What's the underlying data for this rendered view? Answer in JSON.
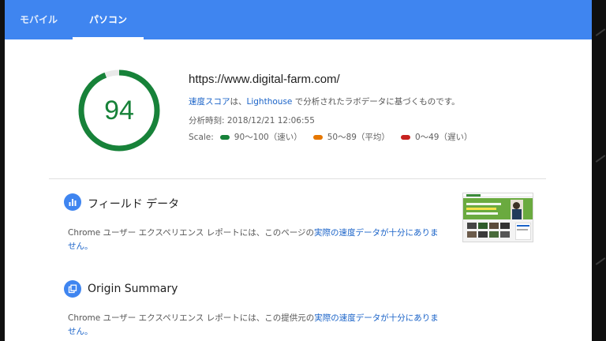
{
  "tabs": [
    {
      "label": "モバイル"
    },
    {
      "label": "パソコン"
    }
  ],
  "score": {
    "value": 94,
    "text": "94",
    "color": "#178239"
  },
  "summary": {
    "url": "https://www.digital-farm.com/",
    "desc_link1": "速度スコア",
    "desc_mid": "は、",
    "desc_link2": "Lighthouse",
    "desc_tail": " で分析されたラボデータに基づくものです。",
    "timestamp": "分析時刻: 2018/12/21 12:06:55"
  },
  "scale": {
    "label": "Scale:",
    "items": [
      {
        "text": "90～100（速い）",
        "color": "#178239"
      },
      {
        "text": "50～89（平均）",
        "color": "#e67700"
      },
      {
        "text": "0～49（遅い）",
        "color": "#c7221f"
      }
    ]
  },
  "field": {
    "title": "フィールド データ",
    "icon": "bar-chart-icon",
    "body_text": "Chrome ユーザー エクスペリエンス レポートには、このページの",
    "body_link": "実際の速度データが十分にありません。"
  },
  "origin": {
    "title": "Origin Summary",
    "icon": "copy-pages-icon",
    "body_text": "Chrome ユーザー エクスペリエンス レポートには、この提供元の",
    "body_link": "実際の速度データが十分にありません。"
  },
  "colors": {
    "accent": "#3f85f0",
    "link": "#1a63c8"
  }
}
